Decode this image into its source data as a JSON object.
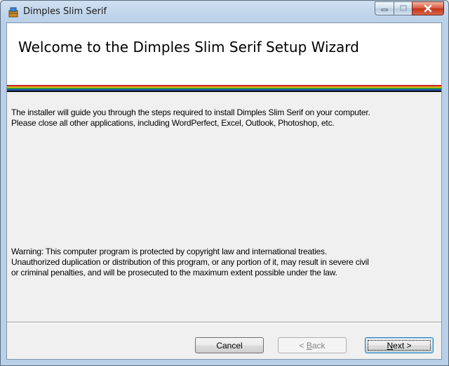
{
  "window": {
    "title": "Dimples Slim Serif"
  },
  "banner": {
    "heading": "Welcome to the Dimples Slim Serif Setup Wizard",
    "stripe_colors": [
      "#c81f1f",
      "#e6b818",
      "#2e9a3a",
      "#1c4fbf",
      "#101010"
    ]
  },
  "content": {
    "intro_line1": "The installer will guide you through the steps required to install Dimples Slim Serif on your computer.",
    "intro_line2": "Please close all other applications, including WordPerfect, Excel, Outlook, Photoshop, etc.",
    "warning_line1": "Warning: This computer program is protected by copyright law and international treaties.",
    "warning_line2": "Unauthorized duplication or distribution of this program, or any portion of it, may result in severe civil",
    "warning_line3": "or criminal penalties, and will be prosecuted to the maximum extent possible under the law."
  },
  "buttons": {
    "cancel_label": "Cancel",
    "back_prefix": "< ",
    "back_accel": "B",
    "back_rest": "ack",
    "next_accel": "N",
    "next_rest": "ext >"
  },
  "icons": {
    "app": "installer-icon",
    "minimize": "minimize-icon",
    "maximize": "maximize-icon",
    "close": "close-icon"
  }
}
